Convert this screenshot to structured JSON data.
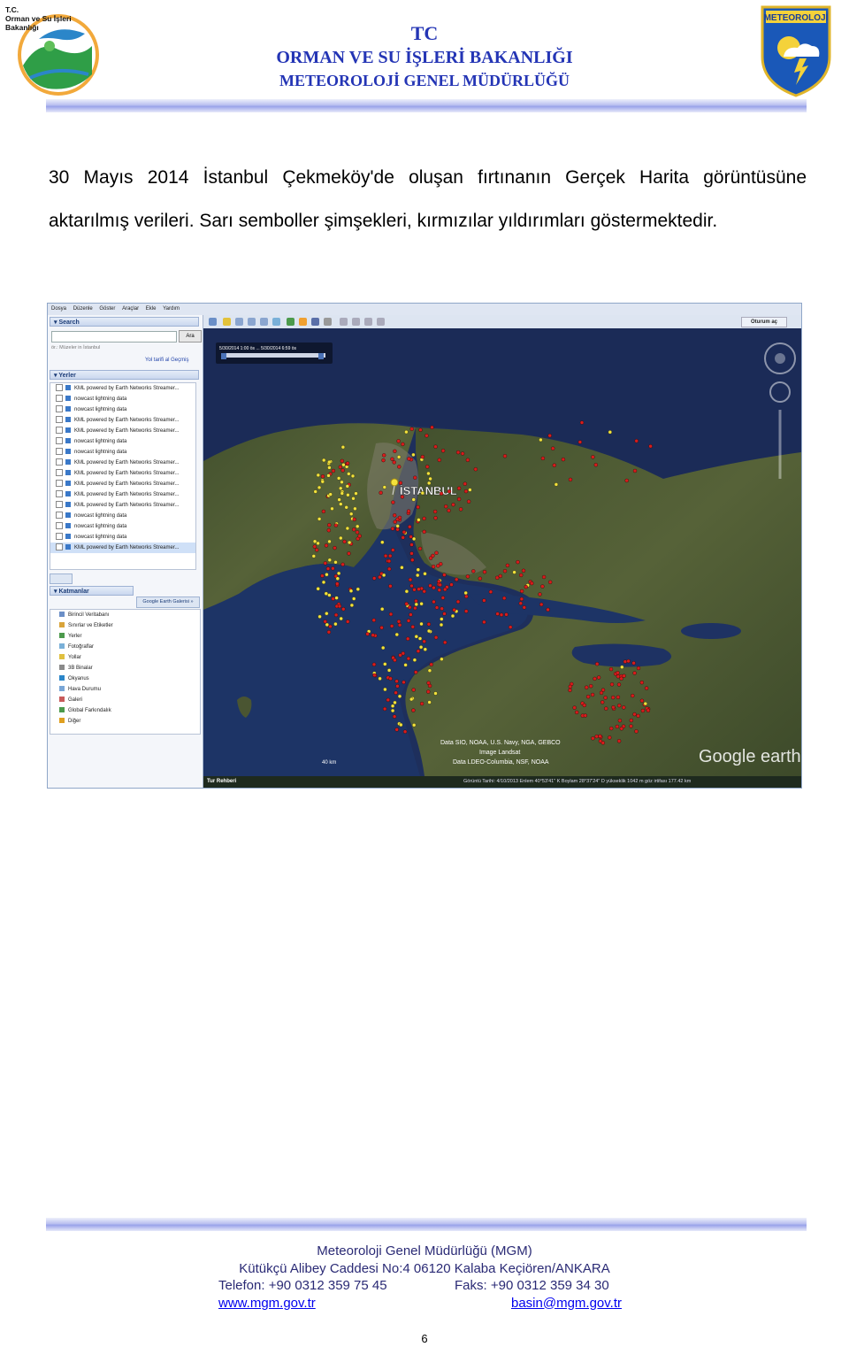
{
  "header": {
    "org_logo_text": [
      "T.C.",
      "Orman ve Su İşleri",
      "Bakanlığı"
    ],
    "line1": "TC",
    "line2": "ORMAN VE SU İŞLERİ BAKANLIĞI",
    "line3": "METEOROLOJİ GENEL MÜDÜRLÜĞÜ",
    "met_logo_text": "METEOROLOJİ"
  },
  "caption": "30 Mayıs 2014 İstanbul Çekmeköy'de oluşan fırtınanın Gerçek Harita görüntüsüne aktarılmış verileri. Sarı semboller şimşekleri, kırmızılar yıldırımları göstermektedir.",
  "screenshot": {
    "menu": [
      "Dosya",
      "Düzenle",
      "Göster",
      "Araçlar",
      "Ekle",
      "Yardım"
    ],
    "search_panel": "Search",
    "search_button": "Ara",
    "search_hint": "ör.: Müzeler in İstanbul",
    "route_links": "Yol tarifi al   Geçmiş",
    "places_panel": "Yerler",
    "places_items": [
      "KML powered by Earth Networks Streamer...",
      "nowcast lightning data",
      "nowcast lightning data",
      "KML powered by Earth Networks Streamer...",
      "KML powered by Earth Networks Streamer...",
      "nowcast lightning data",
      "nowcast lightning data",
      "KML powered by Earth Networks Streamer...",
      "KML powered by Earth Networks Streamer...",
      "KML powered by Earth Networks Streamer...",
      "KML powered by Earth Networks Streamer...",
      "KML powered by Earth Networks Streamer...",
      "nowcast lightning data",
      "nowcast lightning data",
      "nowcast lightning data",
      "KML powered by Earth Networks Streamer..."
    ],
    "layers_panel": "Katmanlar",
    "gallery_button": "Google Earth Galerisi »",
    "layers_items": [
      "Birincil Veritabanı",
      "Sınırlar ve Etiketler",
      "Yerler",
      "Fotoğraflar",
      "Yollar",
      "3B Binalar",
      "Okyanus",
      "Hava Durumu",
      "Galeri",
      "Global Farkındalık",
      "Diğer"
    ],
    "sign_in": "Oturum aç",
    "time_range": "5/30/2014 1:00 ös ... 5/30/2014 6:59 ös",
    "city_label": "İSTANBUL",
    "attribution": [
      "Data SIO, NOAA, U.S. Navy, NGA, GEBCO",
      "Image Landsat",
      "Data LDEO-Columbia, NSF, NOAA"
    ],
    "google_earth": "Google earth",
    "scale": "40 km",
    "tour_guide": "Tur Rehberi",
    "status": "Görüntü Tarihi: 4/10/2013    Enlem  40°53'41\" K  Boylam  28°37'24\" D  yükseklik  1042 m   göz irtifası  177.42 km",
    "colors": {
      "lightning": "#f2e23c",
      "thunderbolt": "#d81c1c"
    }
  },
  "footer": {
    "line1": "Meteoroloji Genel Müdürlüğü (MGM)",
    "line2": "Kütükçü Alibey Caddesi No:4 06120 Kalaba Keçiören/ANKARA",
    "phone": "Telefon: +90 0312 359 75 45",
    "fax": "Faks: +90 0312 359 34 30",
    "website": "www.mgm.gov.tr",
    "email": "basin@mgm.gov.tr"
  },
  "page_number": "6"
}
